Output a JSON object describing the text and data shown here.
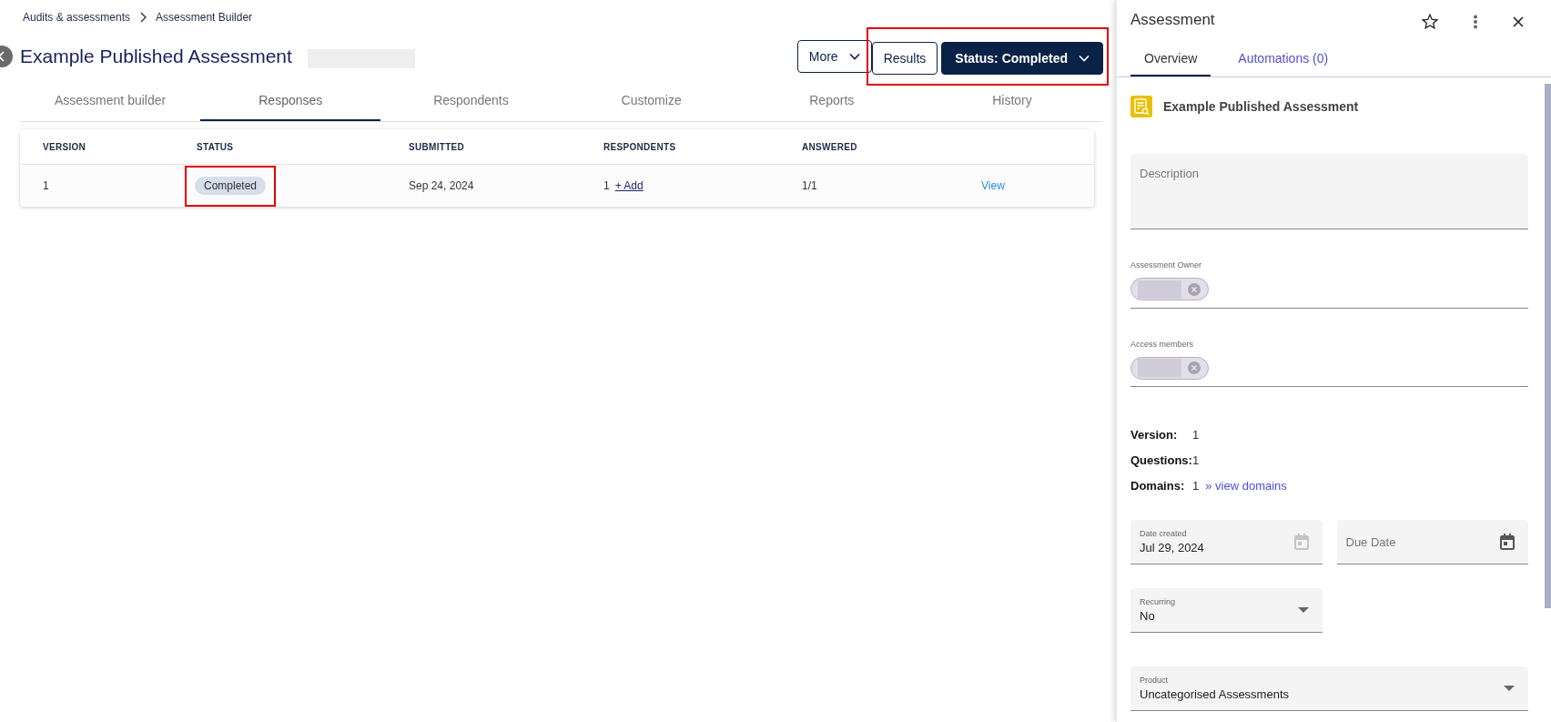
{
  "breadcrumb": [
    {
      "label": "Audits & assessments"
    },
    {
      "label": "Assessment Builder"
    }
  ],
  "header": {
    "title": "Example Published Assessment",
    "buttons": [
      {
        "label": "More",
        "kind": "outline-dropdown",
        "highlighted": false
      },
      {
        "label": "Results",
        "kind": "outline",
        "highlighted": true
      },
      {
        "label": "Status: Completed",
        "kind": "primary-dropdown",
        "highlighted": true
      }
    ]
  },
  "tabs": [
    {
      "label": "Assessment builder",
      "selected": false
    },
    {
      "label": "Responses",
      "selected": true
    },
    {
      "label": "Respondents",
      "selected": false
    },
    {
      "label": "Customize",
      "selected": false
    },
    {
      "label": "Reports",
      "selected": false
    },
    {
      "label": "History",
      "selected": false
    }
  ],
  "table": {
    "columns": [
      "VERSION",
      "STATUS",
      "SUBMITTED",
      "RESPONDENTS",
      "ANSWERED"
    ],
    "rows": [
      {
        "version": "1",
        "status": "Completed",
        "status_highlighted": true,
        "submitted": "Sep 24, 2024",
        "respondents": "1",
        "add_link": "+ Add",
        "answered": "1/1",
        "action": "View"
      }
    ]
  },
  "panel": {
    "title": "Assessment",
    "tabs": [
      {
        "label": "Overview",
        "selected": true
      },
      {
        "label": "Automations (0)",
        "selected": false
      }
    ],
    "heading": "Example Published Assessment",
    "description": {
      "placeholder": "Description"
    },
    "people": [
      {
        "label": "Assessment Owner"
      },
      {
        "label": "Access members"
      }
    ],
    "info": [
      {
        "label": "Version:",
        "value": "1"
      },
      {
        "label": "Questions:",
        "value": "1"
      },
      {
        "label": "Domains:",
        "value": "1",
        "link": "» view domains"
      }
    ],
    "fields": [
      {
        "kind": "date",
        "label": "Date created",
        "value": "Jul 29, 2024",
        "disabled": true
      },
      {
        "kind": "date",
        "placeholder": "Due Date",
        "disabled": false
      },
      {
        "kind": "select",
        "label": "Recurring",
        "value": "No"
      },
      {
        "kind": "wideselect",
        "label": "Product",
        "value": "Uncategorised Assessments"
      }
    ]
  }
}
